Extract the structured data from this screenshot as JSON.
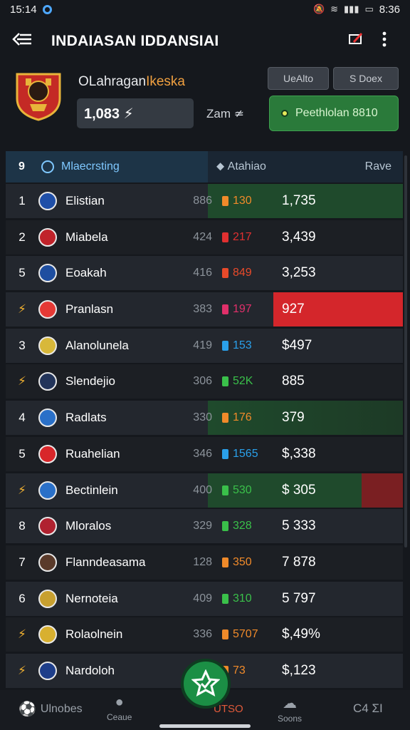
{
  "status": {
    "time": "15:14",
    "right": "8:36"
  },
  "appbar": {
    "title": "INDAIASAN IDDANSIAI"
  },
  "hero": {
    "club_name_a": "OLahragan",
    "club_name_b": "Ikeska",
    "chip_a": "UeAlto",
    "chip_b": "S Doex",
    "score": "1,083 ⚡",
    "zoom": "Zam ≄",
    "green_button": "Peethlolan 8810"
  },
  "table": {
    "header": {
      "rank": "9",
      "team": "Mlaecrsting",
      "stats": "Atahiao",
      "value": "Rave"
    },
    "rows": [
      {
        "pos": "1",
        "name": "Elistian",
        "pts": "886",
        "stat": "130",
        "value": "1,735",
        "stat_color": "#f08a2a",
        "badge_color": "#1f4fa8",
        "row_style": "green"
      },
      {
        "pos": "2",
        "name": "Miabela",
        "pts": "424",
        "stat": "217",
        "value": "3,439",
        "stat_color": "#e03030",
        "badge_color": "#c0232a",
        "row_style": "alt"
      },
      {
        "pos": "5",
        "name": "Eoakah",
        "pts": "416",
        "stat": "849",
        "value": "3,253",
        "stat_color": "#e84a2a",
        "badge_color": "#1e4ea0",
        "row_style": "plain"
      },
      {
        "pos": "",
        "name": "Pranlasn",
        "pts": "383",
        "stat": "197",
        "value": "927",
        "stat_color": "#e0306a",
        "badge_color": "#e53935",
        "row_style": "red"
      },
      {
        "pos": "3",
        "name": "Alanolunela",
        "pts": "419",
        "stat": "153",
        "value": "$497",
        "stat_color": "#2aa0ea",
        "badge_color": "#d8b83a",
        "row_style": "plain"
      },
      {
        "pos": "",
        "name": "Slendejio",
        "pts": "306",
        "stat": "52K",
        "value": "885",
        "stat_color": "#3ac04a",
        "badge_color": "#22345a",
        "row_style": "alt"
      },
      {
        "pos": "4",
        "name": "Radlats",
        "pts": "330",
        "stat": "176",
        "value": "379",
        "stat_color": "#f08a2a",
        "badge_color": "#2a70c8",
        "row_style": "greenfade"
      },
      {
        "pos": "5",
        "name": "Ruahelian",
        "pts": "346",
        "stat": "1565",
        "value": "$,338",
        "stat_color": "#2aa0ea",
        "badge_color": "#d8262a",
        "row_style": "alt"
      },
      {
        "pos": "",
        "name": "Bectinlein",
        "pts": "400",
        "stat": "530",
        "value": "$ 305",
        "stat_color": "#3ac04a",
        "badge_color": "#2a70c8",
        "row_style": "greenred"
      },
      {
        "pos": "8",
        "name": "Mloralos",
        "pts": "329",
        "stat": "328",
        "value": "5 333",
        "stat_color": "#3ac04a",
        "badge_color": "#b02230",
        "row_style": "plain"
      },
      {
        "pos": "7",
        "name": "Flanndeasama",
        "pts": "128",
        "stat": "350",
        "value": "7 878",
        "stat_color": "#f08a2a",
        "badge_color": "#5a3a2a",
        "row_style": "alt"
      },
      {
        "pos": "6",
        "name": "Nernoteia",
        "pts": "409",
        "stat": "310",
        "value": "5 797",
        "stat_color": "#3ac04a",
        "badge_color": "#c8a030",
        "row_style": "plain"
      },
      {
        "pos": "",
        "name": "Rolaolnein",
        "pts": "336",
        "stat": "5707",
        "value": "$,49%",
        "stat_color": "#f08a2a",
        "badge_color": "#d8b030",
        "row_style": "alt"
      },
      {
        "pos": "",
        "name": "Nardoloh",
        "pts": "",
        "stat": "73",
        "value": "$,123",
        "stat_color": "#f08a2a",
        "badge_color": "#1e3e8a",
        "row_style": "plain"
      }
    ]
  },
  "bottomnav": {
    "item1": "Ulnobes",
    "item2": "Ceaue",
    "item3": "UTSO",
    "item4": "Soons",
    "item5": "C4 ΣI"
  }
}
